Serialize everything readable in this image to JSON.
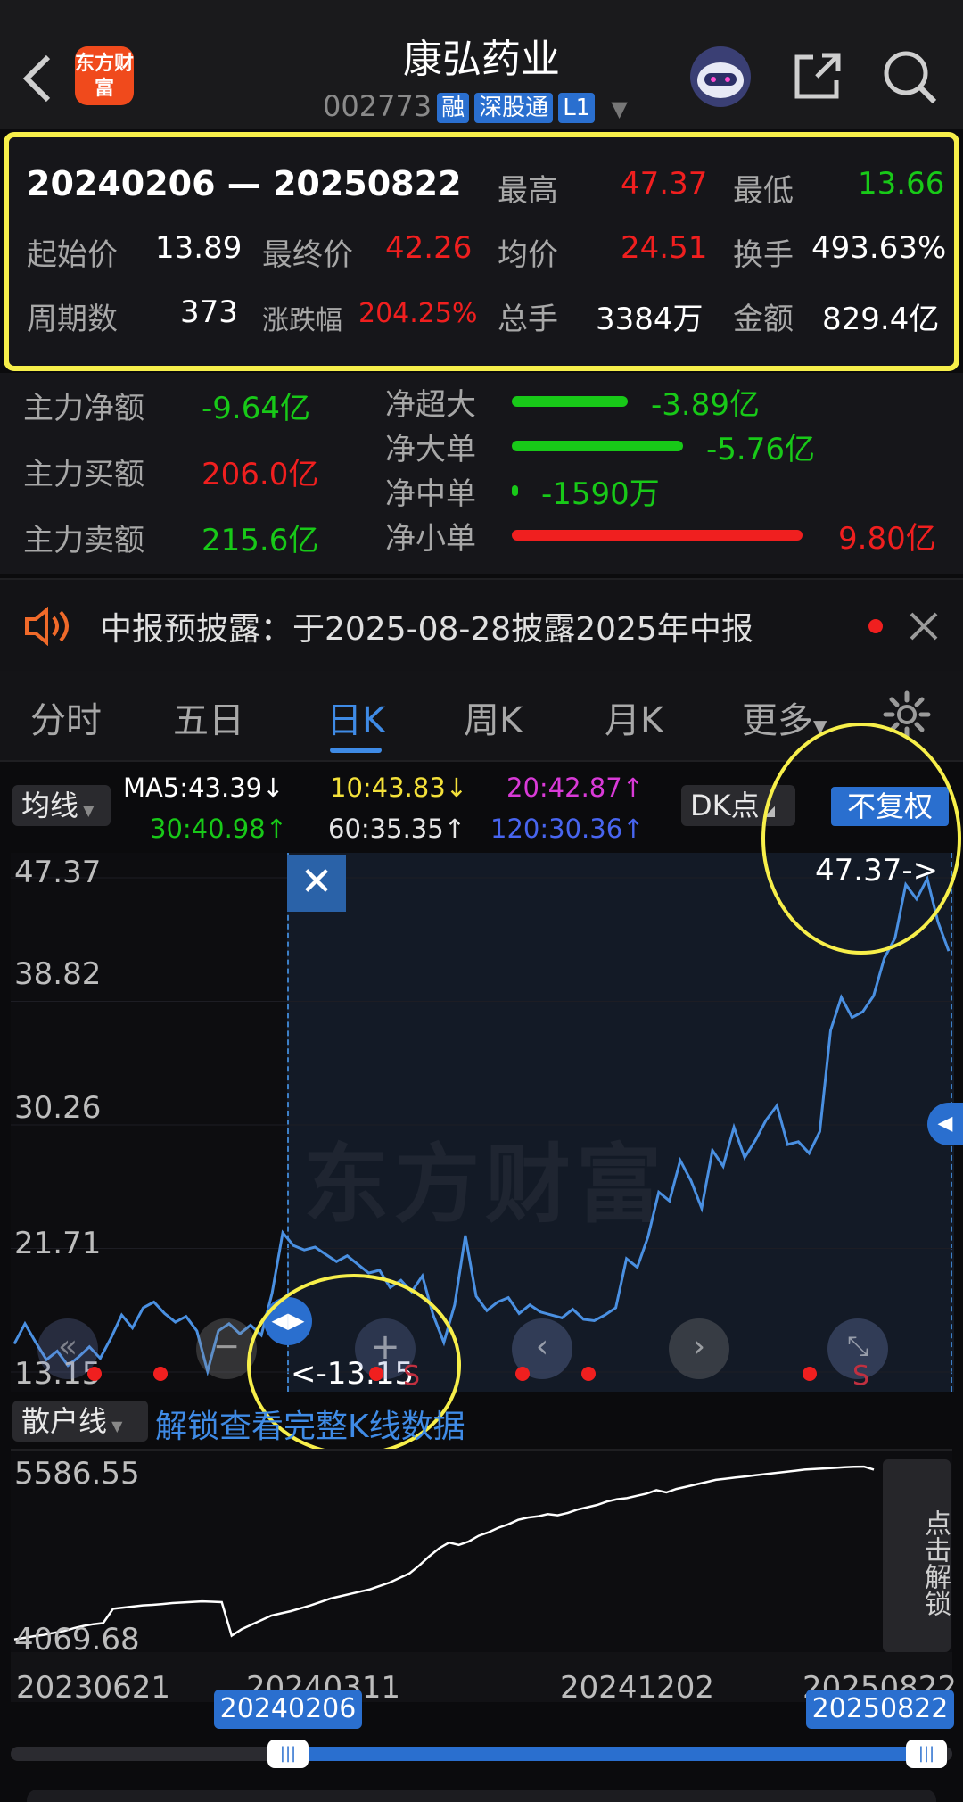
{
  "header": {
    "logo": "东方财富",
    "title": "康弘药业",
    "code": "002773",
    "tags": [
      "融",
      "深股通",
      "L1"
    ]
  },
  "stats": {
    "range": "20240206 — 20250822",
    "high_label": "最高",
    "high": "47.37",
    "low_label": "最低",
    "low": "13.66",
    "open_label": "起始价",
    "open": "13.89",
    "close_label": "最终价",
    "close": "42.26",
    "avg_label": "均价",
    "avg": "24.51",
    "turnover_label": "换手",
    "turnover": "493.63%",
    "periods_label": "周期数",
    "periods": "373",
    "change_label": "涨跌幅",
    "change": "204.25%",
    "volume_label": "总手",
    "volume": "3384万",
    "amount_label": "金额",
    "amount": "829.4亿"
  },
  "flows": {
    "main_net_label": "主力净额",
    "main_net": "-9.64亿",
    "main_buy_label": "主力买额",
    "main_buy": "206.0亿",
    "main_sell_label": "主力卖额",
    "main_sell": "215.6亿",
    "items": [
      {
        "label": "净超大",
        "value": "-3.89亿",
        "color": "#18c918",
        "fill": 0.4
      },
      {
        "label": "净大单",
        "value": "-5.76亿",
        "color": "#18c918",
        "fill": 0.59
      },
      {
        "label": "净中单",
        "value": "-1590万",
        "color": "#18c918",
        "fill": 0.02
      },
      {
        "label": "净小单",
        "value": "9.80亿",
        "color": "#f01f1f",
        "fill": 1.0
      }
    ]
  },
  "notice": {
    "text": "中报预披露：于2025-08-28披露2025年中报"
  },
  "tabs": [
    "分时",
    "五日",
    "日K",
    "周K",
    "月K",
    "更多"
  ],
  "active_tab": "日K",
  "chart": {
    "indicator_select": "均线",
    "ma": {
      "ma5": "MA5:43.39↓",
      "ma10": "10:43.83↓",
      "ma20": "20:42.87↑",
      "ma30": "30:40.98↑",
      "ma60": "60:35.35↑",
      "ma120": "120:30.36↑"
    },
    "dk_select": "DK点",
    "adjust_button": "不复权",
    "y_ticks": [
      "47.37",
      "38.82",
      "30.26",
      "21.71",
      "13.15"
    ],
    "max_marker": "47.37->",
    "min_marker": "<-13.15",
    "watermark": "东方财富",
    "sub_select": "散户线",
    "unlock_link": "解锁查看完整K线数据",
    "sub_high": "5586.55",
    "sub_low": "4069.68",
    "unlock_side": "点击解锁",
    "x_labels": [
      "20230621",
      "20240311",
      "20241202",
      "20250822"
    ],
    "range_start": "20240206",
    "range_end": "20250822",
    "price_series": [
      15.1,
      16.5,
      15.2,
      14.0,
      14.6,
      13.6,
      14.2,
      14.9,
      14.1,
      15.5,
      17.1,
      16.2,
      17.6,
      18.0,
      17.2,
      16.6,
      17.0,
      16.0,
      13.2,
      16.0,
      16.5,
      15.8,
      16.4,
      15.7,
      18.6,
      22.8,
      21.9,
      21.6,
      21.8,
      21.3,
      20.8,
      21.2,
      20.6,
      20.0,
      20.2,
      19.0,
      19.5,
      18.7,
      19.8,
      17.1,
      15.2,
      17.8,
      22.6,
      18.4,
      17.4,
      18.0,
      18.3,
      17.2,
      17.8,
      17.3,
      17.1,
      16.9,
      17.5,
      16.8,
      16.7,
      17.1,
      17.6,
      21.0,
      20.4,
      22.5,
      25.6,
      25.0,
      27.8,
      26.4,
      24.5,
      28.5,
      27.4,
      30.1,
      28.0,
      29.2,
      30.6,
      31.6,
      28.9,
      29.1,
      28.3,
      29.8,
      36.8,
      39.1,
      37.7,
      38.1,
      39.2,
      41.8,
      43.2,
      46.9,
      45.9,
      47.3,
      44.3,
      42.3
    ],
    "retail_series": [
      4072,
      4085,
      4100,
      4112,
      4130,
      4145,
      4170,
      4190,
      4205,
      4215,
      4340,
      4350,
      4360,
      4370,
      4375,
      4382,
      4390,
      4395,
      4400,
      4405,
      4402,
      4398,
      4105,
      4160,
      4200,
      4240,
      4280,
      4300,
      4320,
      4345,
      4370,
      4400,
      4430,
      4450,
      4470,
      4490,
      4510,
      4540,
      4570,
      4610,
      4650,
      4720,
      4800,
      4870,
      4920,
      4900,
      4930,
      4980,
      5010,
      5050,
      5080,
      5120,
      5140,
      5150,
      5170,
      5160,
      5180,
      5210,
      5230,
      5250,
      5280,
      5300,
      5310,
      5330,
      5350,
      5380,
      5360,
      5390,
      5410,
      5430,
      5450,
      5470,
      5480,
      5490,
      5500,
      5510,
      5520,
      5530,
      5540,
      5550,
      5560,
      5565,
      5570,
      5575,
      5580,
      5584,
      5586,
      5560
    ]
  }
}
